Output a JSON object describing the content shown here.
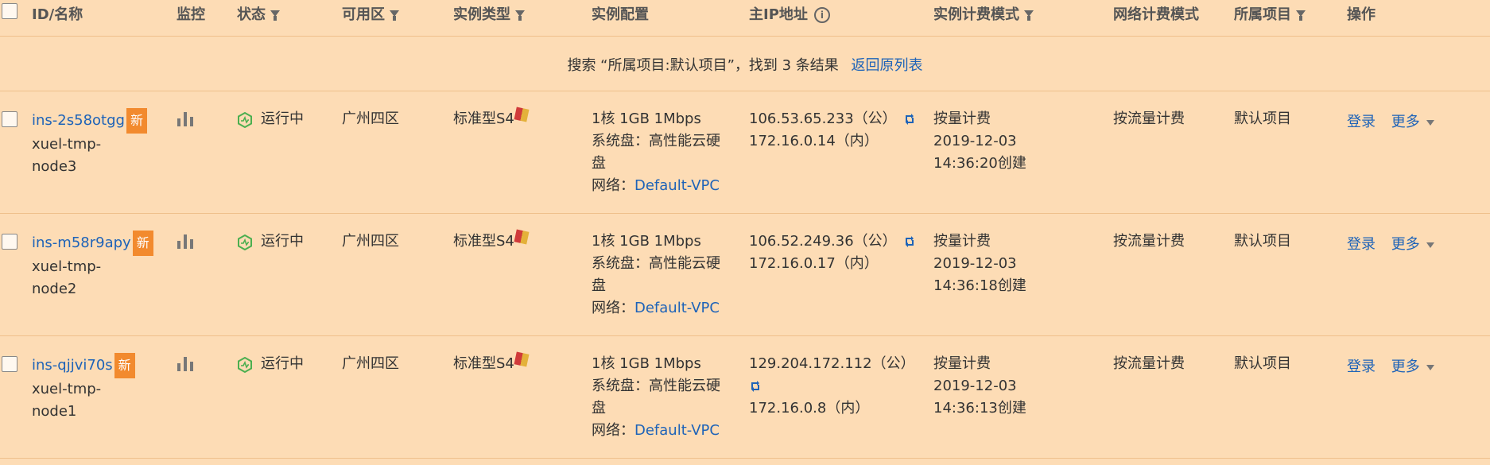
{
  "header": {
    "id_name": "ID/名称",
    "monitor": "监控",
    "status": "状态",
    "zone": "可用区",
    "type": "实例类型",
    "config": "实例配置",
    "ip": "主IP地址",
    "billing": "实例计费模式",
    "net_billing": "网络计费模式",
    "project": "所属项目",
    "ops": "操作"
  },
  "search_bar": {
    "text": "搜索 “所属项目:默认项目”，找到 3 条结果",
    "back_link": "返回原列表"
  },
  "rows": [
    {
      "id": "ins-2s58otgg",
      "badge": "新",
      "name1": "xuel-tmp-",
      "name2": "node3",
      "status": "运行中",
      "zone": "广州四区",
      "type": "标准型S4",
      "cfg1": "1核 1GB 1Mbps",
      "cfg2": "系统盘：高性能云硬",
      "cfg3": "盘",
      "net_label": "网络：",
      "net_link": "Default-VPC",
      "ip_public": "106.53.65.233（公）",
      "ip_private": "172.16.0.14（内）",
      "bill1": "按量计费",
      "bill2": "2019-12-03",
      "bill3": "14:36:20创建",
      "net_billing": "按流量计费",
      "project": "默认项目",
      "login": "登录",
      "more": "更多"
    },
    {
      "id": "ins-m58r9apy",
      "badge": "新",
      "name1": "xuel-tmp-",
      "name2": "node2",
      "status": "运行中",
      "zone": "广州四区",
      "type": "标准型S4",
      "cfg1": "1核 1GB 1Mbps",
      "cfg2": "系统盘：高性能云硬",
      "cfg3": "盘",
      "net_label": "网络：",
      "net_link": "Default-VPC",
      "ip_public": "106.52.249.36（公）",
      "ip_private": "172.16.0.17（内）",
      "bill1": "按量计费",
      "bill2": "2019-12-03",
      "bill3": "14:36:18创建",
      "net_billing": "按流量计费",
      "project": "默认项目",
      "login": "登录",
      "more": "更多"
    },
    {
      "id": "ins-qjjvi70s",
      "badge": "新",
      "name1": "xuel-tmp-",
      "name2": "node1",
      "status": "运行中",
      "zone": "广州四区",
      "type": "标准型S4",
      "cfg1": "1核 1GB 1Mbps",
      "cfg2": "系统盘：高性能云硬",
      "cfg3": "盘",
      "net_label": "网络：",
      "net_link": "Default-VPC",
      "ip_public": "129.204.172.112（公）",
      "ip_private": "172.16.0.8（内）",
      "bill1": "按量计费",
      "bill2": "2019-12-03",
      "bill3": "14:36:13创建",
      "net_billing": "按流量计费",
      "project": "默认项目",
      "login": "登录",
      "more": "更多"
    }
  ],
  "colors": {
    "background": "#fddcb5",
    "link": "#1e63b8",
    "badge": "#f28a2e",
    "running": "#4caf50"
  }
}
